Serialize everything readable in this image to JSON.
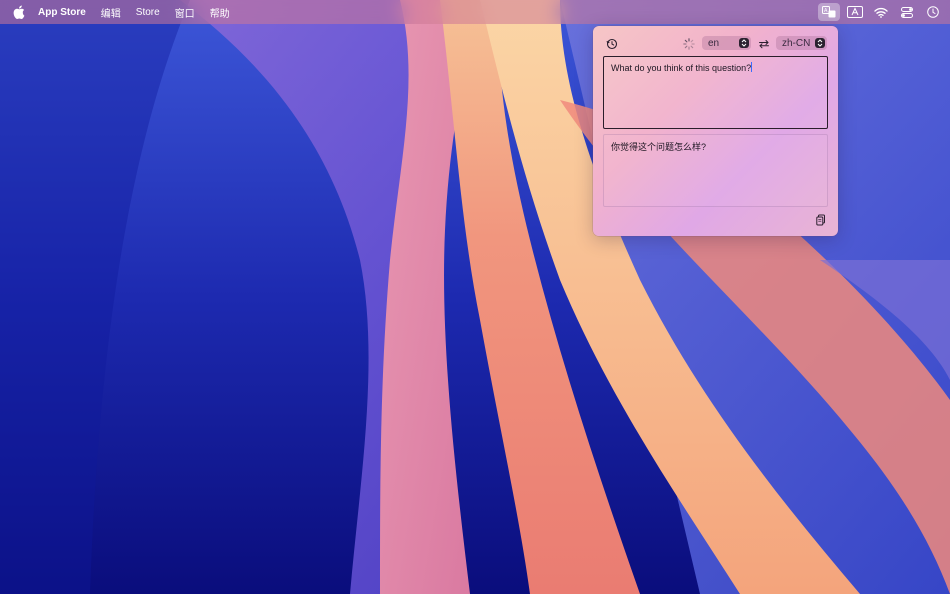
{
  "menubar": {
    "app_name": "App Store",
    "menus": [
      "编辑",
      "Store",
      "窗口",
      "帮助"
    ],
    "status_icons": [
      "translate-icon",
      "input-method-icon",
      "wifi-icon",
      "control-center-icon",
      "clock-icon"
    ]
  },
  "translator": {
    "source_language": "en",
    "target_language": "zh-CN",
    "source_text": "What do you think of this question?",
    "translated_text": "你觉得这个问题怎么样?"
  },
  "colors": {
    "accent_cursor": "#3b6cff",
    "panel_gradient_start": "#f6c6c6",
    "panel_gradient_end": "#e0a8e6"
  }
}
